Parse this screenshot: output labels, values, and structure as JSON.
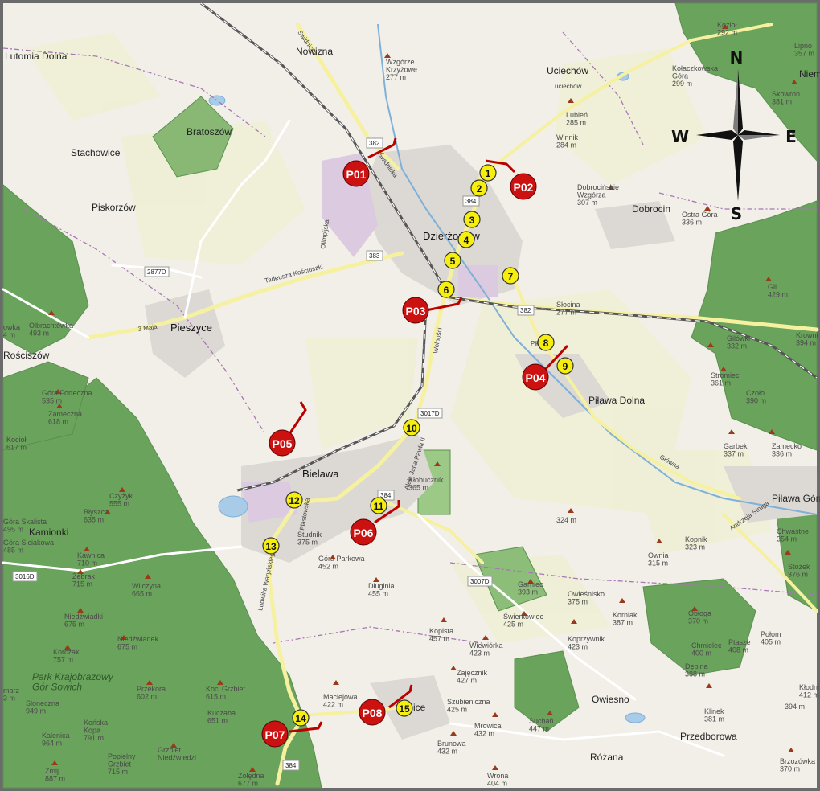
{
  "colors": {
    "background": "#f2efe9",
    "forest": "#6aa35b",
    "farmland": "#eef0d5",
    "residential": "#dcd8d3",
    "industrial": "#dccae0",
    "water": "#a8cbe8",
    "road_major": "#f6f1a0",
    "road_primary": "#f9cf8a",
    "railway": "#555555",
    "admin_border": "#a777b4",
    "checkpoint_yellow": "#f5ee10",
    "checkpoint_red": "#cc1111",
    "frame": "#6b6b6b"
  },
  "compass": {
    "north": "N",
    "south": "S",
    "east": "E",
    "west": "W"
  },
  "places": {
    "lutomia_dolna": "Lutomia Dolna",
    "nowizna": "Nowizna",
    "wzgorze_krzyzowe": "Wzgórze\nKrzyżowe\n277 m",
    "uciechow": "Uciechów",
    "uciechowka": "uciechów",
    "koziol": "Kozioł\n292 m",
    "lipno": "Lipno\n357 m",
    "niem": "Niem",
    "kolaczkowska": "Kołaczkowska\nGóra\n299 m",
    "skowron": "Skowron\n381 m",
    "bratoszow": "Bratoszów",
    "stachowice": "Stachowice",
    "lubien": "Lubień\n285 m",
    "winnik": "Winnik\n284 m",
    "dobrocinskie": "Dobrocińskie\nWzgórza\n307 m",
    "dobrocin": "Dobrocin",
    "ostra_gora": "Ostra Góra\n336 m",
    "piskorzow": "Piskorzów",
    "dzierzoniow": "Dzierżoniów",
    "gil": "Gil\n429 m",
    "road_2877d": "2877D",
    "tadeusza": "Tadeusza Kościuszki",
    "slocina": "Słocina\n277 m",
    "olbrachtowka": "Olbrachtówka\n493 m",
    "owka": "owka\n4 m",
    "pieszyce": "Pieszyce",
    "rosciszow": "Rościszów",
    "gilowki": "Gilówki\n332 m",
    "krowni": "Krowni\n394 m",
    "stromiec": "Stromiec\n361 m",
    "czolo": "Czoło\n390 m",
    "pilawa_dolna": "Piława Dolna",
    "gora_forteczna": "Góra Forteczna\n535 m",
    "zameczna": "Zameczna\n618 m",
    "kociol": "Kocioł\n617 m",
    "road_3017d": "3017D",
    "garbek": "Garbek\n337 m",
    "zamecko": "Zamecko\n336 m",
    "bielawa": "Bielawa",
    "czyzyk": "Czyżyk\n555 m",
    "blyszcz": "Błyszcz\n635 m",
    "gora_skalista": "Góra Skalista\n495 m",
    "kamionki": "Kamionki",
    "gora_siciakowa": "Góra Siciakowa\n485 m",
    "klobucznik": "Kłobucznik\n365 m",
    "pilawa_gorna": "Piława Górn",
    "studnik": "Studnik\n375 m",
    "m324": "324 m",
    "chwastne": "Chwastne\n354 m",
    "kopnik": "Kopnik\n323 m",
    "kawnica": "Kawnica\n710 m",
    "gora_parkowa": "Góra Parkowa\n452 m",
    "owniia": "Ownia\n315 m",
    "stozek_376": "Stożek\n376 m",
    "road_3016d": "3016D",
    "zebrak": "Żebrak\n715 m",
    "wilczyna": "Wilczyna\n665 m",
    "dlugiinia": "Długinia\n455 m",
    "road_3007d": "3007D",
    "garniec": "Garniec\n393 m",
    "owiesnisko": "Owieśnisko\n375 m",
    "korniak": "Korniak\n387 m",
    "obloga": "Obłoga\n370 m",
    "niedzwiadki": "Niedźwiadki\n675 m",
    "swierkowiec": "Świerkowiec\n425 m",
    "koprzywnik": "Koprzywnik\n423 m",
    "polom": "Połom\n405 m",
    "niedzwiadek": "Niedźwiadek\n675 m",
    "kopista": "Kopista\n457 m",
    "chmielec": "Chmielec\n400 m",
    "ptasze": "Ptasze\n408 m",
    "korczak": "Korczak\n757 m",
    "wiewiorka": "Wiewiórka\n423 m",
    "debina": "Dębina\n388 m",
    "zajecznik": "Zajęcznik\n427 m",
    "park_krajobrazowy": "Park Krajobrazowy\nGór Sowich",
    "przekora": "Przekora\n602 m",
    "koci_grzbiet": "Koci Grzbiet\n615 m",
    "maciejowa": "Maciejowa\n422 m",
    "szubieniczna": "Szubieniczna\n425 m",
    "owiesno": "Owiesno",
    "kladnica": "Kłodni\n412 m",
    "slonecznа": "Słoneczna\n949 m",
    "kuczaba": "Kuczaba\n651 m",
    "klinek": "Klinek\n381 m",
    "m394": "394 m",
    "konska_kopa": "Końska\nKopa\n791 m",
    "mrowica": "Mrowica\n432 m",
    "suchan": "Suchań\n447 m",
    "przedborowa": "Przedborowa",
    "kalenica": "Kalenica\n964 m",
    "brunowa": "Brunowa\n432 m",
    "rozana": "Różana",
    "popielny": "Popielny\nGrzbiet\n715 m",
    "grzbiet_niedzwiedzi": "Grzbiet\nNiedźwiedzi",
    "brzozowka": "Brzozówka\n370 m",
    "zmij": "Żmij\n887 m",
    "zoledna": "Żołędna\n677 m",
    "wrona": "Wrona\n404 m",
    "road_384_bottom": "384",
    "road_382_top": "382",
    "road_383": "383",
    "road_384_mid": "384",
    "road_382_right": "382",
    "road_384_bielawa": "384",
    "marz": "marz\n3 m",
    "kice": "ice"
  },
  "road_names": {
    "swidnicka_a": "Świdnicka",
    "swidnicka_b": "Świdnicka",
    "olimpijska": "Olimpijska",
    "piastowska": "Piastowska",
    "wolnosci": "Wolności",
    "pilawa_river": "Piława",
    "andrzeja_struga": "Andrzeja Struga",
    "glowna": "Główna",
    "aleja_jana": "Aleja Jana Pawła II",
    "lwowska": "Ludwika Waryńskiego",
    "rynek": "Rynek",
    "trzeciego_maja": "3 Maja"
  },
  "checkpoints_yellow": [
    "1",
    "2",
    "3",
    "4",
    "5",
    "6",
    "7",
    "8",
    "9",
    "10",
    "11",
    "12",
    "13",
    "14",
    "15"
  ],
  "checkpoints_red": [
    "P01",
    "P02",
    "P03",
    "P04",
    "P05",
    "P06",
    "P07",
    "P08"
  ]
}
